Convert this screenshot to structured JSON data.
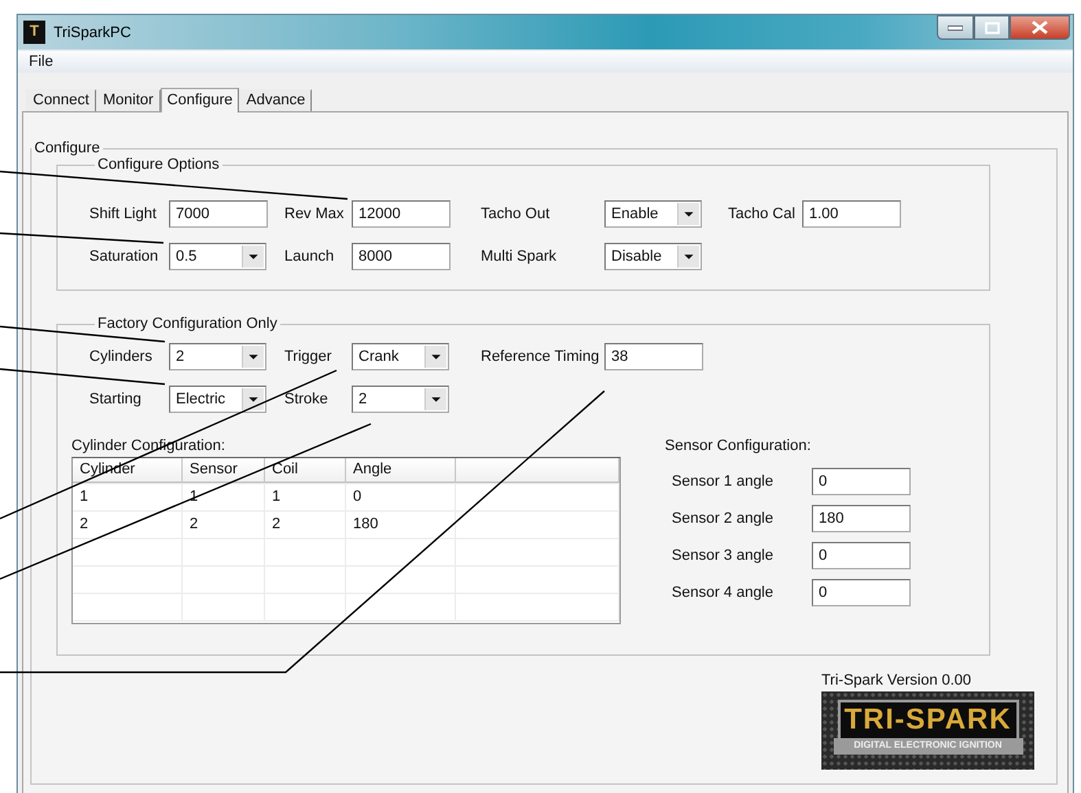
{
  "window": {
    "app_icon": "T",
    "title": "TriSparkPC"
  },
  "menu": [
    "File"
  ],
  "tabs": [
    {
      "label": "Connect",
      "selected": false
    },
    {
      "label": "Monitor",
      "selected": false
    },
    {
      "label": "Configure",
      "selected": true
    },
    {
      "label": "Advance",
      "selected": false
    }
  ],
  "configure": {
    "title": "Configure",
    "options": {
      "title": "Configure Options",
      "rows": [
        [
          {
            "label": "Shift Light",
            "kind": "text",
            "value": "7000"
          },
          {
            "label": "Rev Max",
            "kind": "text",
            "value": "12000"
          },
          {
            "label": "Tacho Out",
            "kind": "select",
            "value": "Enable"
          },
          {
            "label": "Tacho Cal",
            "kind": "text",
            "value": "1.00"
          }
        ],
        [
          {
            "label": "Saturation",
            "kind": "select",
            "value": "0.5"
          },
          {
            "label": "Launch",
            "kind": "text",
            "value": "8000"
          },
          {
            "label": "Multi Spark",
            "kind": "select",
            "value": "Disable"
          }
        ]
      ]
    },
    "factory": {
      "title": "Factory Configuration Only",
      "rows": [
        [
          {
            "label": "Cylinders",
            "kind": "select",
            "value": "2"
          },
          {
            "label": "Trigger",
            "kind": "select",
            "value": "Crank"
          },
          {
            "label": "Reference Timing",
            "kind": "text",
            "value": "38"
          }
        ],
        [
          {
            "label": "Starting",
            "kind": "select",
            "value": "Electric"
          },
          {
            "label": "Stroke",
            "kind": "select",
            "value": "2"
          }
        ]
      ],
      "cylinder_configuration": {
        "title": "Cylinder Configuration:",
        "columns": [
          "Cylinder",
          "Sensor",
          "Coil",
          "Angle"
        ],
        "rows": [
          [
            "1",
            "1",
            "1",
            "0"
          ],
          [
            "2",
            "2",
            "2",
            "180"
          ]
        ]
      },
      "sensor_configuration": {
        "title": "Sensor Configuration:",
        "sensors": [
          {
            "label": "Sensor 1 angle",
            "value": "0"
          },
          {
            "label": "Sensor 2 angle",
            "value": "180"
          },
          {
            "label": "Sensor 3 angle",
            "value": "0"
          },
          {
            "label": "Sensor 4 angle",
            "value": "0"
          }
        ]
      }
    }
  },
  "version": "Tri-Spark Version 0.00",
  "logo": {
    "title": "TRI-SPARK",
    "subtitle": "DIGITAL ELECTRONIC IGNITION"
  }
}
